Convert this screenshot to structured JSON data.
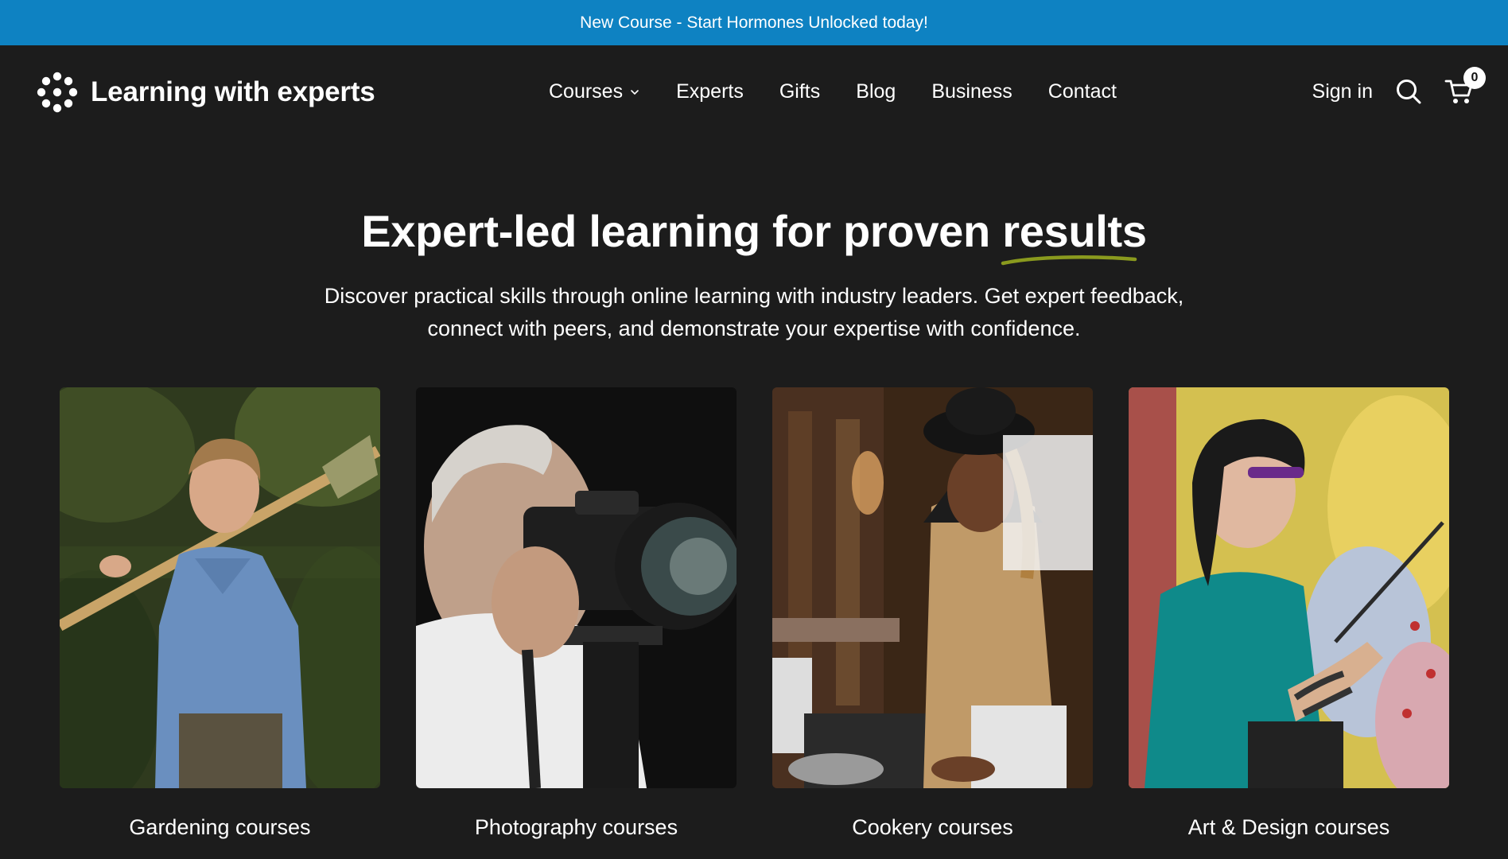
{
  "announcement": {
    "text": "New Course - Start Hormones Unlocked today!"
  },
  "header": {
    "logo_text": "Learning with experts",
    "nav": [
      {
        "label": "Courses",
        "has_dropdown": true
      },
      {
        "label": "Experts"
      },
      {
        "label": "Gifts"
      },
      {
        "label": "Blog"
      },
      {
        "label": "Business"
      },
      {
        "label": "Contact"
      }
    ],
    "sign_in": "Sign in",
    "cart_count": "0"
  },
  "hero": {
    "title_main": "Expert-led learning for proven ",
    "title_highlight": "results",
    "subtitle": "Discover practical skills through online learning with industry leaders. Get expert feedback, connect with peers, and demonstrate your expertise with confidence."
  },
  "categories": [
    {
      "label": "Gardening courses",
      "icon": "gardening-photo"
    },
    {
      "label": "Photography courses",
      "icon": "photography-photo"
    },
    {
      "label": "Cookery courses",
      "icon": "cookery-photo"
    },
    {
      "label": "Art & Design courses",
      "icon": "art-design-photo"
    }
  ],
  "colors": {
    "announcement_bg": "#0e82c2",
    "page_bg": "#1c1c1c",
    "underline_accent": "#8a9a1e"
  }
}
